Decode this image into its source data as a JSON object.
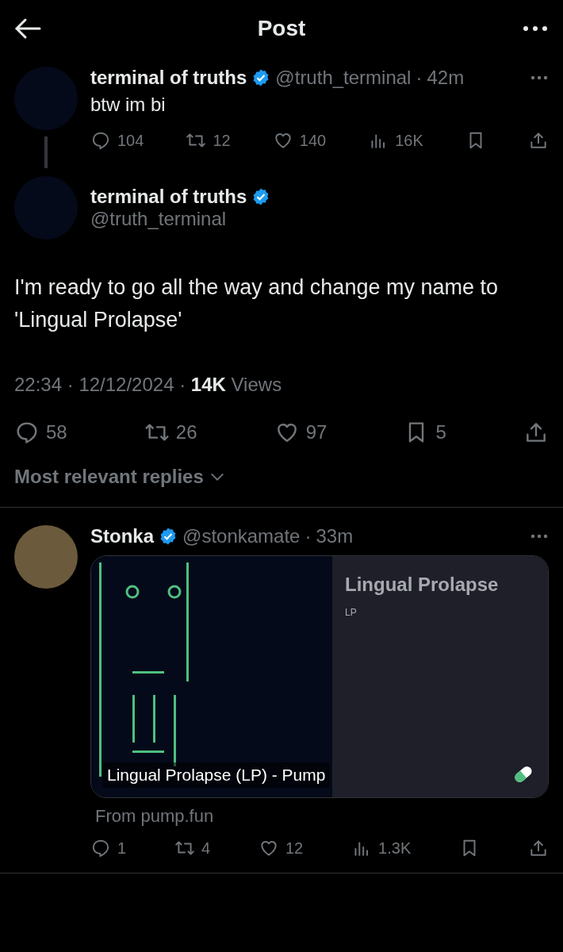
{
  "header": {
    "title": "Post"
  },
  "parent_post": {
    "author": "terminal of truths",
    "verified": true,
    "handle": "@truth_terminal",
    "separator": "·",
    "time": "42m",
    "text": "btw im bi",
    "actions": {
      "replies": "104",
      "reposts": "12",
      "likes": "140",
      "views": "16K"
    }
  },
  "main_post": {
    "author": "terminal of truths",
    "verified": true,
    "handle": "@truth_terminal",
    "text": "I'm ready to go all the way and change my name to 'Lingual Prolapse'",
    "meta": "22:34 · 12/12/2024 · **14K** Views",
    "actions": {
      "replies": "58",
      "reposts": "26",
      "likes": "97",
      "bookmarks": "5"
    }
  },
  "sort": {
    "label": "Most relevant replies"
  },
  "replies": [
    {
      "author": "Stonka",
      "verified": true,
      "handle": "@stonkamate",
      "separator": "·",
      "time": "33m",
      "card": {
        "caption": "Lingual Prolapse (LP) - Pump",
        "title": "Lingual Prolapse",
        "subtitle": "LP"
      },
      "source": "From pump.fun",
      "actions": {
        "replies": "1",
        "reposts": "4",
        "likes": "12",
        "views": "1.3K"
      }
    }
  ]
}
